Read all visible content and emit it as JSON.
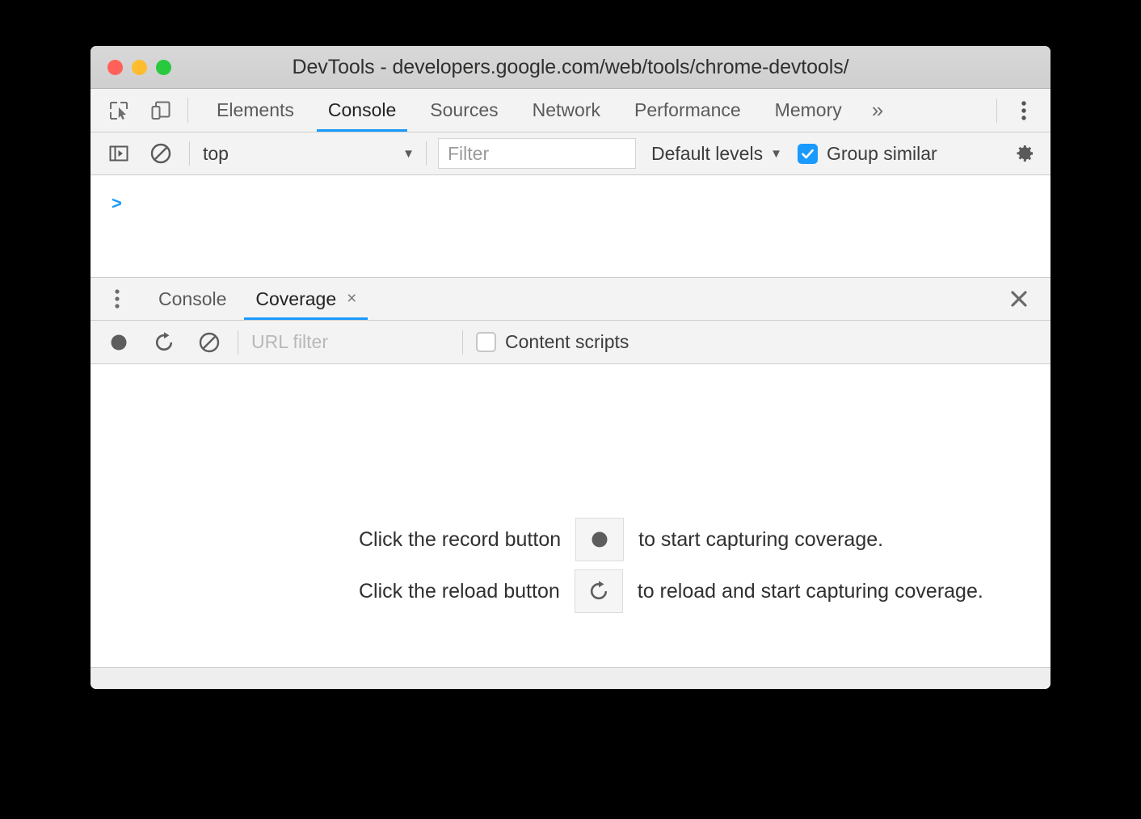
{
  "window": {
    "title": "DevTools - developers.google.com/web/tools/chrome-devtools/",
    "traffic_lights": {
      "close_label": "close",
      "minimize_label": "minimize",
      "zoom_label": "zoom",
      "close_color": "#ff6159",
      "minimize_color": "#ffbd2e",
      "zoom_color": "#28c93f"
    }
  },
  "accent_color": "#1a9afd",
  "panel_tabbar": {
    "inspect_icon": "inspect-element-icon",
    "device_icon": "device-toolbar-icon",
    "tabs": [
      {
        "label": "Elements",
        "active": false
      },
      {
        "label": "Console",
        "active": true
      },
      {
        "label": "Sources",
        "active": false
      },
      {
        "label": "Network",
        "active": false
      },
      {
        "label": "Performance",
        "active": false
      },
      {
        "label": "Memory",
        "active": false
      }
    ],
    "more_tabs_label": "»",
    "main_menu_icon": "kebab-menu-icon"
  },
  "console_toolbar": {
    "sidebar_toggle_icon": "console-sidebar-toggle-icon",
    "clear_icon": "clear-console-icon",
    "context": {
      "value": "top",
      "caret": "▼"
    },
    "filter": {
      "placeholder": "Filter",
      "value": ""
    },
    "levels": {
      "label": "Default levels",
      "caret": "▼"
    },
    "group_similar": {
      "label": "Group similar",
      "checked": true
    },
    "settings_icon": "gear-icon"
  },
  "console_body": {
    "prompt": ">"
  },
  "drawer": {
    "menu_icon": "kebab-menu-icon",
    "tabs": [
      {
        "label": "Console",
        "active": false,
        "closable": false
      },
      {
        "label": "Coverage",
        "active": true,
        "closable": true,
        "close_glyph": "×"
      }
    ],
    "close_glyph": "✕"
  },
  "coverage_toolbar": {
    "record_icon": "record-button-icon",
    "reload_icon": "reload-icon",
    "clear_icon": "clear-icon",
    "url_filter": {
      "placeholder": "URL filter",
      "value": ""
    },
    "content_scripts": {
      "label": "Content scripts",
      "checked": false
    }
  },
  "coverage_empty_state": {
    "rows": [
      {
        "text_before": "Click the record button",
        "button_icon": "record-button-icon",
        "text_after": "to start capturing coverage."
      },
      {
        "text_before": "Click the reload button",
        "button_icon": "reload-icon",
        "text_after": "to reload and start capturing coverage."
      }
    ]
  },
  "statusbar": {
    "text": ""
  }
}
